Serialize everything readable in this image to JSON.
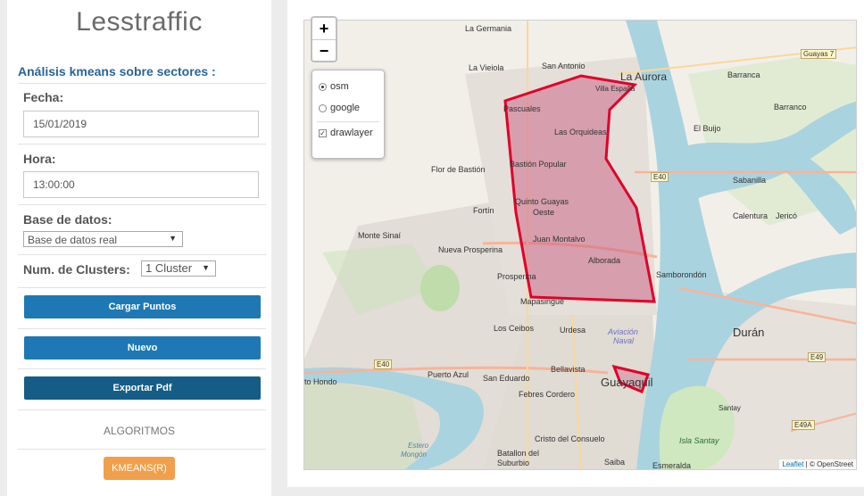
{
  "sidebar": {
    "app_title": "Lesstraffic",
    "subtitle": "Análisis kmeans sobre sectores :",
    "fecha_label": "Fecha:",
    "fecha_value": "15/01/2019",
    "hora_label": "Hora:",
    "hora_value": "13:00:00",
    "db_label": "Base de datos:",
    "db_value": "Base de datos real",
    "clusters_label": "Num. de Clusters:",
    "clusters_value": "1 Cluster",
    "btn_cargar": "Cargar Puntos",
    "btn_nuevo": "Nuevo",
    "btn_exportar": "Exportar Pdf",
    "algoritmos": "ALGORITMOS",
    "btn_kmeans": "KMEANS(R)"
  },
  "map": {
    "zoom_in": "+",
    "zoom_out": "−",
    "layers": [
      {
        "label": "osm",
        "type": "radio",
        "checked": true
      },
      {
        "label": "google",
        "type": "radio",
        "checked": false
      },
      {
        "label": "drawlayer",
        "type": "checkbox",
        "checked": true
      }
    ],
    "attribution_link": "Leaflet",
    "attribution_rest": " | © OpenStreet",
    "places": [
      "La Germania",
      "San Antonio",
      "La Aurora",
      "Barranca",
      "Guayas 7",
      "La Vieiola",
      "Villa España",
      "Pascuales",
      "Barranco",
      "Las Orquideas",
      "El Buijo",
      "Flor de Bastión",
      "Bastión Popular",
      "E40",
      "Sabanilla",
      "Quinto Guayas",
      "Oeste",
      "Fortín",
      "Calentura",
      "Jericó",
      "Monte Sinaí",
      "Juan Montalvo",
      "Nueva Prosperina",
      "Alborada",
      "Samborondón",
      "Prosperina",
      "Mapasingue",
      "Los Ceibos",
      "Urdesa",
      "Aviación",
      "Naval",
      "Durán",
      "E49",
      "E40",
      "Puerto Azul",
      "Bellavista",
      "San Eduardo",
      "Guayaquil",
      "Febres Cordero",
      "Santay",
      "E49A",
      "Isla Santay",
      "Cristo del Consuelo",
      "Batallon del",
      "Suburbio",
      "Saiba",
      "Esmeralda",
      "Estero",
      "Mongón",
      "to Hondo"
    ]
  },
  "colors": {
    "button_blue": "#1e78b4",
    "button_dark": "#155d86",
    "button_orange": "#f0a04b",
    "polygon_stroke": "#e0002a",
    "polygon_fill": "#c8507a",
    "water": "#a9d3df"
  }
}
